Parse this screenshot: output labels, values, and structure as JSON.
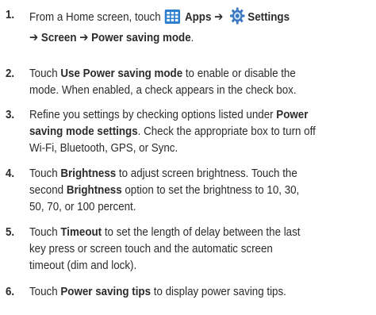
{
  "steps": [
    {
      "number": "1.",
      "line1": {
        "t1": "From a Home screen, touch ",
        "icon1": "apps-grid-icon",
        "b1": "Apps ➔ ",
        "icon2": "gear-icon",
        "b2": "Settings"
      },
      "line2": {
        "b1": "➔ Screen ➔ Power saving mode",
        "t1": "."
      }
    },
    {
      "number": "2.",
      "line1": {
        "t1": "Touch ",
        "b1": "Use Power saving mode",
        "t2": " to enable or disable the"
      },
      "line2": {
        "t1": "mode. When enabled, a check appears in the check box."
      }
    },
    {
      "number": "3.",
      "line1": {
        "t1": "Refine you settings by checking options listed under ",
        "b1": "Power"
      },
      "line2": {
        "b1": "saving mode settings",
        "t1": ". Check the appropriate box to turn off"
      },
      "line3": {
        "t1": "Wi-Fi, Bluetooth, GPS, or Sync."
      }
    },
    {
      "number": "4.",
      "line1": {
        "t1": "Touch ",
        "b1": "Brightness",
        "t2": " to adjust screen brightness. Touch the"
      },
      "line2": {
        "t1": "second ",
        "b1": "Brightness",
        "t2": " option to set the brightness to 10, 30,"
      },
      "line3": {
        "t1": "50, 70, or 100 percent."
      }
    },
    {
      "number": "5.",
      "line1": {
        "t1": "Touch ",
        "b1": "Timeout",
        "t2": " to set the length of delay between the last"
      },
      "line2": {
        "t1": "key press or screen touch and the automatic screen"
      },
      "line3": {
        "t1": "timeout (dim and lock)."
      }
    },
    {
      "number": "6.",
      "line1": {
        "t1": "Touch ",
        "b1": "Power saving tips",
        "t2": " to display power saving tips."
      }
    }
  ],
  "colors": {
    "text": "#2b2b2b",
    "apps_icon_bg": "#2f7fd0",
    "gear_icon": "#3a78c2"
  }
}
